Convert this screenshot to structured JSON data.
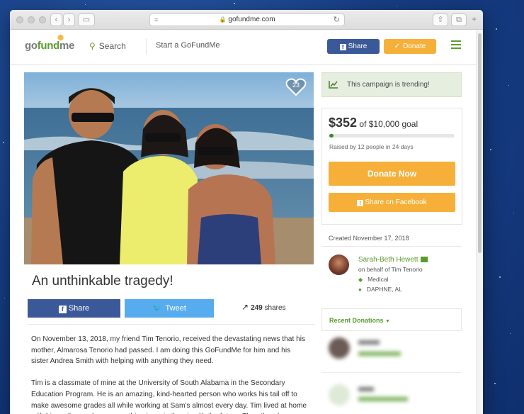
{
  "browser": {
    "url": "gofundme.com"
  },
  "header": {
    "logo_go": "go",
    "logo_fund": "fund",
    "logo_me": "me",
    "search_label": "Search",
    "start_label": "Start a GoFundMe",
    "share_label": "Share",
    "donate_label": "Donate"
  },
  "campaign": {
    "heart_count": "23",
    "title": "An unthinkable tragedy!",
    "share_button": "Share",
    "tweet_button": "Tweet",
    "shares_count": "249",
    "shares_label": "shares",
    "story": [
      "On November 13,  2018,  my friend Tim  Tenorio, received the devastating news that his mother, Almarosa  Tenorio had passed. I am doing this GoFundMe for him and his sister Andrea Smith with helping with anything they need.",
      "Tim is a classmate of mine at the University of South Alabama in the Secondary Education Program. He is an amazing, kind-hearted person who works his tail off to make awesome grades all while working at Sam's almost every day. Tim lived at home with his mother and now everything is up in the air with the future. The other day"
    ]
  },
  "sidebar": {
    "trending": "This campaign is trending!",
    "raised_amount": "$352",
    "goal_text": "of $10,000 goal",
    "progress_fraction": 0.0352,
    "raised_by": "Raised by 12 people in 24 days",
    "donate_now": "Donate Now",
    "share_facebook": "Share on Facebook",
    "created": "Created November 17, 2018",
    "organizer_name": "Sarah-Beth Hewett",
    "organizer_behalf": "on behalf of Tim Tenorio",
    "category": "Medical",
    "location": "DAPHNE, AL",
    "recent_donations": "Recent Donations"
  },
  "colors": {
    "facebook": "#3b5998",
    "twitter": "#56acee",
    "donate": "#f6b03a",
    "brand_green": "#5a9b2e"
  },
  "icons": {
    "trend": "trend-chart-icon",
    "tag": "tag-icon",
    "location": "pin-icon",
    "verified": "verified-badge-icon"
  }
}
